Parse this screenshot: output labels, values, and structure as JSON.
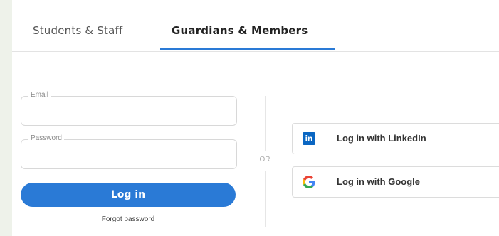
{
  "tabs": [
    {
      "label": "Students & Staff",
      "active": false
    },
    {
      "label": "Guardians & Members",
      "active": true
    }
  ],
  "form": {
    "email_label": "Email",
    "email_value": "",
    "password_label": "Password",
    "password_value": "",
    "login_label": "Log in",
    "forgot_label": "Forgot password"
  },
  "separator": "OR",
  "social": {
    "linkedin_label": "Log in with LinkedIn",
    "linkedin_icon": "linkedin-icon",
    "google_label": "Log in with Google",
    "google_icon": "google-icon"
  },
  "colors": {
    "accent": "#2a7ad6",
    "linkedin": "#0a66c2"
  }
}
